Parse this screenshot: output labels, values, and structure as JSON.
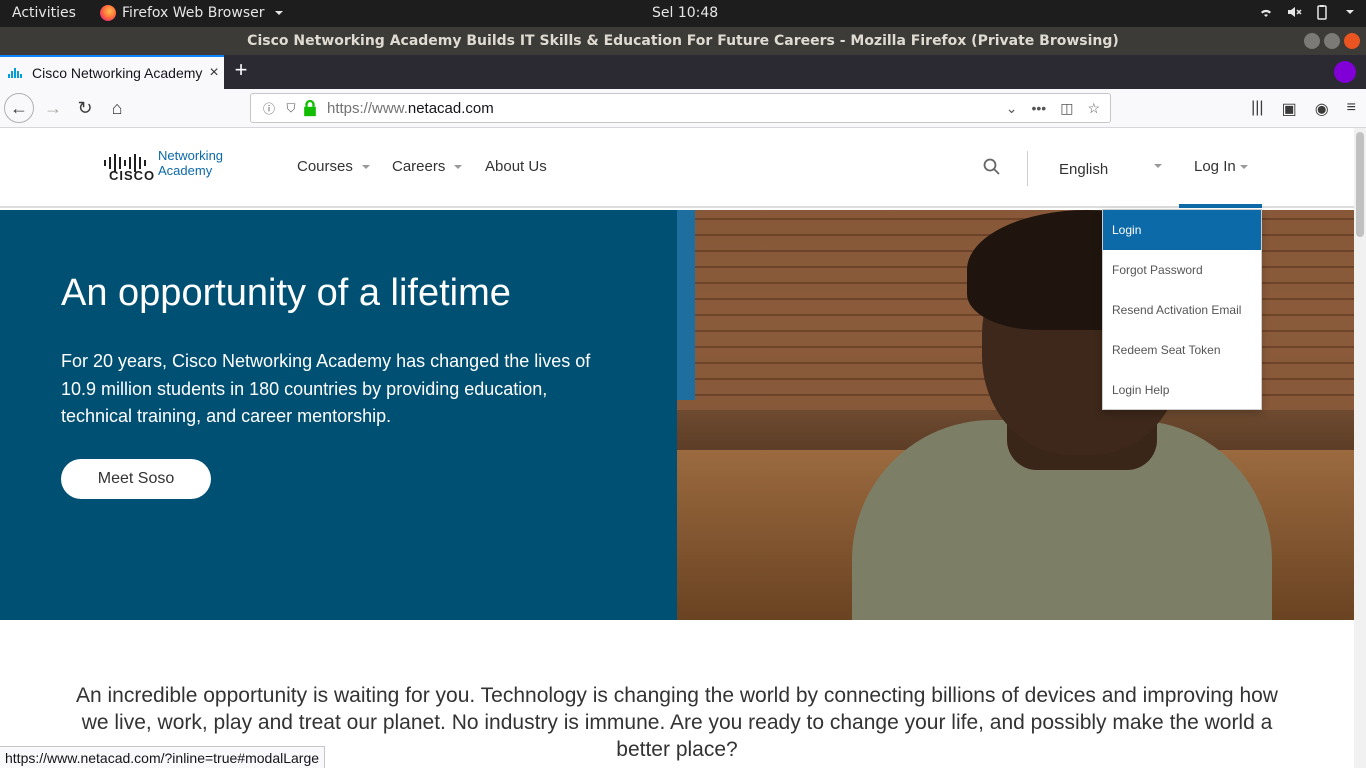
{
  "topbar": {
    "activities": "Activities",
    "app_name": "Firefox Web Browser",
    "clock": "Sel 10:48"
  },
  "window": {
    "title": "Cisco Networking Academy Builds IT Skills & Education For Future Careers - Mozilla Firefox (Private Browsing)"
  },
  "tab": {
    "title": "Cisco Networking Academy Builds IT Skills"
  },
  "urlbar": {
    "prefix": "https://www.",
    "domain": "netacad.com"
  },
  "site": {
    "logo_word": "CISCO",
    "logo_line1": "Networking",
    "logo_line2": "Academy",
    "nav": {
      "courses": "Courses",
      "careers": "Careers",
      "about": "About Us"
    },
    "language": "English",
    "login": "Log In"
  },
  "dropdown": {
    "items": [
      "Login",
      "Forgot Password",
      "Resend Activation Email",
      "Redeem Seat Token",
      "Login Help"
    ],
    "active_color": "#0d6aa8"
  },
  "hero": {
    "title": "An opportunity of a lifetime",
    "body": "For 20 years, Cisco Networking Academy has changed the lives of 10.9 million students in 180 countries by providing education, technical training, and career mentorship.",
    "button": "Meet Soso",
    "bg_color": "#005073"
  },
  "lead": {
    "text": "An incredible opportunity is waiting for you. Technology is changing the world by connecting billions of devices and improving how we live, work, play and treat our planet. No industry is immune. Are you ready to change your life, and possibly make the world a better place?"
  },
  "statusbar": {
    "url": "https://www.netacad.com/?inline=true#modalLarge"
  }
}
